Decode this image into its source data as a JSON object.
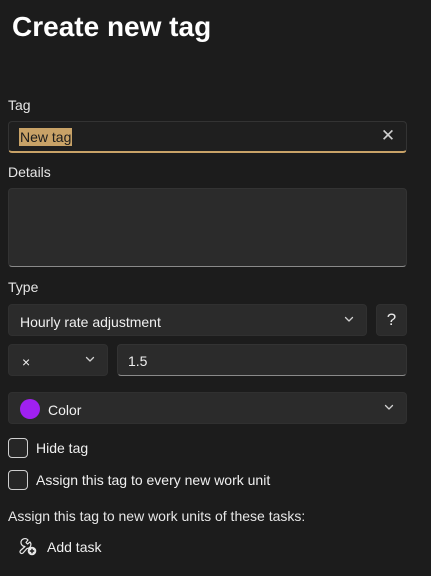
{
  "dialog": {
    "title": "Create new tag"
  },
  "tag": {
    "label": "Tag",
    "value": "New tag",
    "clear_icon": "close-icon"
  },
  "details": {
    "label": "Details",
    "value": ""
  },
  "type": {
    "label": "Type",
    "selected": "Hourly rate adjustment",
    "help_label": "?"
  },
  "adjustment": {
    "operator": "×",
    "value": "1.5"
  },
  "color": {
    "label": "Color",
    "swatch": "#a020f0"
  },
  "options": {
    "hide_tag": {
      "label": "Hide tag",
      "checked": false
    },
    "assign_every": {
      "label": "Assign this tag to every new work unit",
      "checked": false
    }
  },
  "tasks": {
    "label": "Assign this tag to new work units of these tasks:",
    "add_label": "Add task",
    "add_icon": "add-task-icon"
  },
  "colors": {
    "accent": "#c8a267",
    "background": "#1c1c1c",
    "control": "#2b2b2b"
  }
}
